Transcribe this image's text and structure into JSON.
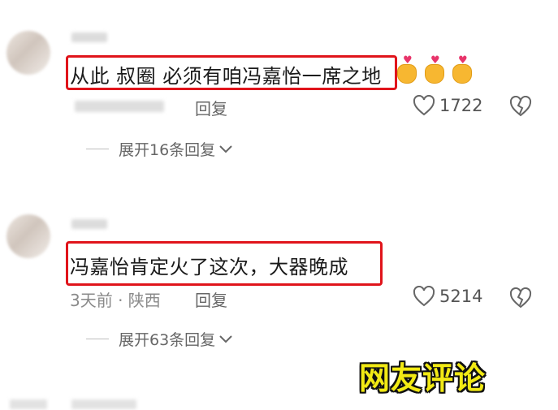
{
  "comments": [
    {
      "text": "从此 叔圈 必须有咱冯嘉怡一席之地",
      "reply_label": "回复",
      "likes": "1722",
      "expand_label": "展开16条回复",
      "emoji": "heart-hands-icon"
    },
    {
      "text": "冯嘉怡肯定火了这次，大器晚成",
      "time_location": "3天前 · 陕西",
      "reply_label": "回复",
      "likes": "5214",
      "expand_label": "展开63条回复"
    }
  ],
  "overlay_caption": "网友评论",
  "colors": {
    "highlight_border": "#e0141b",
    "caption_fill": "#f2ea14",
    "meta_text": "#8a8a8a"
  }
}
